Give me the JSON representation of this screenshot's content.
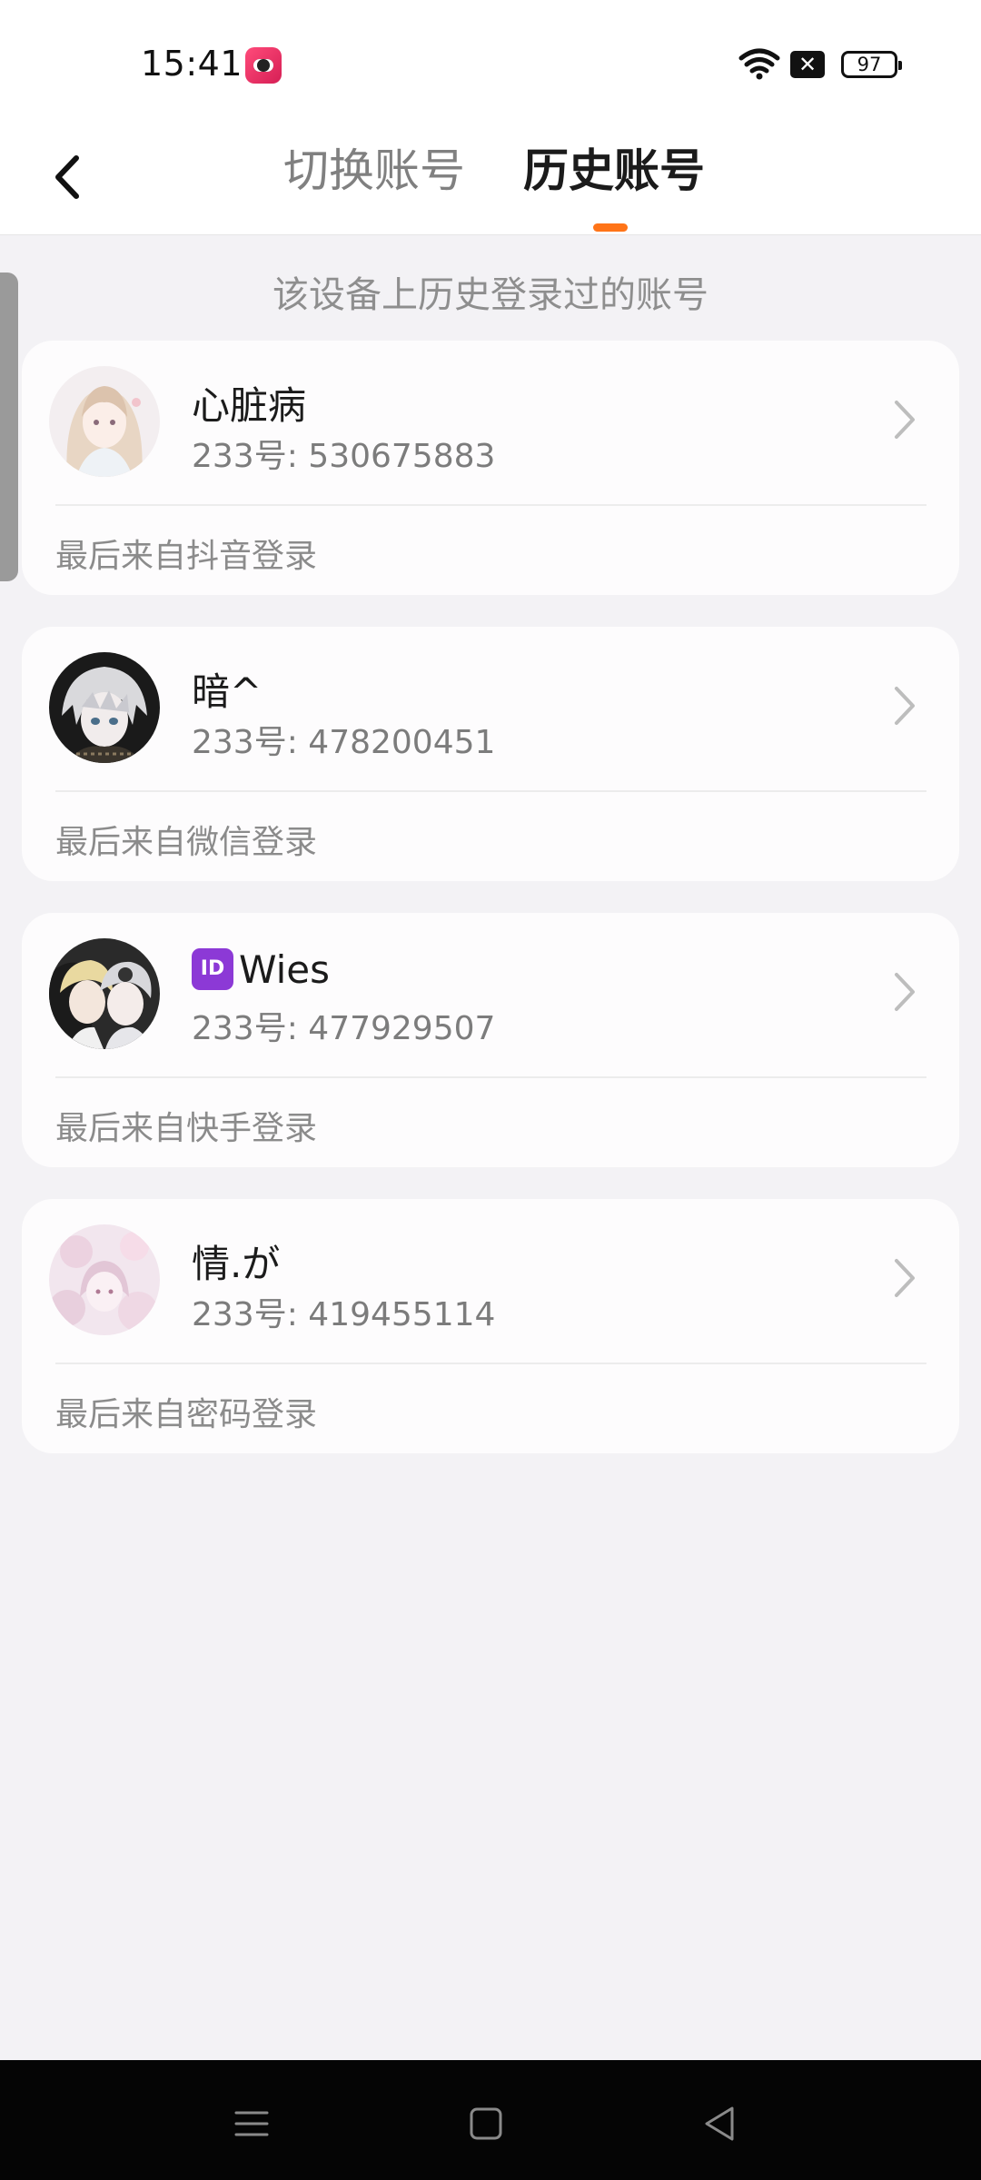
{
  "status_bar": {
    "time": "15:41",
    "battery": "97",
    "icons": [
      "app-notification-icon",
      "wifi-icon",
      "sim-blocked-icon",
      "battery-icon"
    ]
  },
  "header": {
    "tabs": [
      {
        "label": "切换账号",
        "active": false
      },
      {
        "label": "历史账号",
        "active": true
      }
    ],
    "accent_color": "#ff7418"
  },
  "subtitle": "该设备上历史登录过的账号",
  "accounts": [
    {
      "name": "心脏病",
      "id_text": "233号: 530675883",
      "login_source": "最后来自抖音登录"
    },
    {
      "name": "暗^",
      "id_text": "233号: 478200451",
      "login_source": "最后来自微信登录"
    },
    {
      "name_emoji": "ID",
      "name": "Wies",
      "id_text": "233号: 477929507",
      "login_source": "最后来自快手登录"
    },
    {
      "name": "情.が",
      "id_text": "233号: 419455114",
      "login_source": "最后来自密码登录"
    }
  ],
  "nav_bar": {
    "icons": [
      "menu-icon",
      "home-icon",
      "back-icon"
    ]
  }
}
